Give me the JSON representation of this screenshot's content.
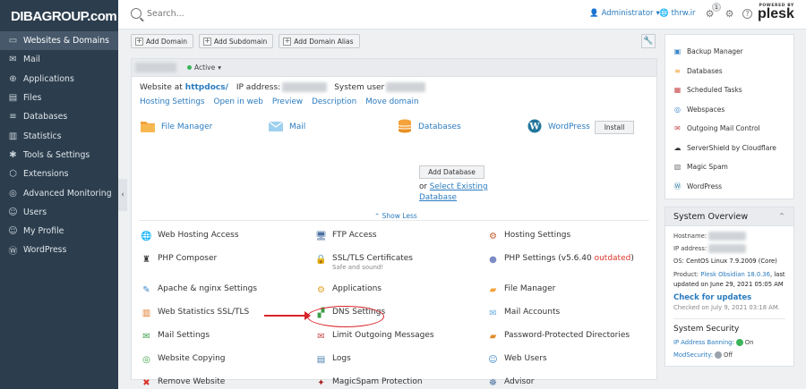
{
  "brand": {
    "logo_text": "DIBAGROUP.com"
  },
  "sidebar": {
    "items": [
      {
        "label": "Websites & Domains",
        "icon": "monitor-icon",
        "active": true
      },
      {
        "label": "Mail",
        "icon": "mail-icon"
      },
      {
        "label": "Applications",
        "icon": "applications-icon"
      },
      {
        "label": "Files",
        "icon": "files-icon"
      },
      {
        "label": "Databases",
        "icon": "database-icon"
      },
      {
        "label": "Statistics",
        "icon": "statistics-icon"
      },
      {
        "label": "Tools & Settings",
        "icon": "tools-icon"
      },
      {
        "label": "Extensions",
        "icon": "extensions-icon"
      },
      {
        "label": "Advanced Monitoring",
        "icon": "monitoring-icon"
      },
      {
        "label": "Users",
        "icon": "users-icon"
      },
      {
        "label": "My Profile",
        "icon": "profile-icon"
      },
      {
        "label": "WordPress",
        "icon": "wordpress-icon"
      }
    ]
  },
  "header": {
    "search_placeholder": "Search...",
    "user": "Administrator",
    "site": "thrw.ir",
    "notification_count": "1",
    "powered_by": "POWERED BY",
    "plesk": "plesk"
  },
  "toolbar": {
    "add_domain": "Add Domain",
    "add_subdomain": "Add Subdomain",
    "add_domain_alias": "Add Domain Alias"
  },
  "domain": {
    "status": "Active",
    "website_at_label": "Website at",
    "website_path": "httpdocs/",
    "ip_label": "IP address:",
    "system_user_label": "System user"
  },
  "domain_links": [
    "Hosting Settings",
    "Open in web",
    "Preview",
    "Description",
    "Move domain"
  ],
  "services": {
    "file_manager": "File Manager",
    "mail": "Mail",
    "databases": "Databases",
    "add_database": "Add Database",
    "or_text": "or",
    "select_existing": "Select Existing Database",
    "wordpress": "WordPress",
    "install": "Install"
  },
  "show_less": "Show Less",
  "tools": [
    {
      "label": "Web Hosting Access",
      "icon": "web-hosting-icon"
    },
    {
      "label": "FTP Access",
      "icon": "ftp-icon"
    },
    {
      "label": "Hosting Settings",
      "icon": "hosting-settings-icon"
    },
    {
      "label": "PHP Composer",
      "icon": "php-composer-icon"
    },
    {
      "label": "SSL/TLS Certificates",
      "sub": "Safe and sound!",
      "icon": "ssl-lock-icon"
    },
    {
      "label": "PHP Settings (v5.6.40 ",
      "extra": "outdated",
      "tail": ")",
      "icon": "php-icon"
    },
    {
      "label": "Apache & nginx Settings",
      "icon": "apache-nginx-icon"
    },
    {
      "label": "Applications",
      "icon": "applications-gear-icon"
    },
    {
      "label": "File Manager",
      "icon": "folder-icon"
    },
    {
      "label": "Web Statistics SSL/TLS",
      "icon": "web-statistics-icon"
    },
    {
      "label": "DNS Settings",
      "icon": "dns-icon"
    },
    {
      "label": "Mail Accounts",
      "icon": "mail-accounts-icon"
    },
    {
      "label": "Mail Settings",
      "icon": "mail-settings-icon"
    },
    {
      "label": "Limit Outgoing Messages",
      "icon": "limit-mail-icon"
    },
    {
      "label": "Password-Protected Directories",
      "icon": "protected-dir-icon"
    },
    {
      "label": "Website Copying",
      "icon": "website-copy-icon"
    },
    {
      "label": "Logs",
      "icon": "logs-icon"
    },
    {
      "label": "Web Users",
      "icon": "web-users-icon"
    },
    {
      "label": "Remove Website",
      "icon": "remove-icon"
    },
    {
      "label": "MagicSpam Protection",
      "icon": "magicspam-icon"
    },
    {
      "label": "Advisor",
      "icon": "advisor-icon"
    }
  ],
  "right_links": [
    {
      "label": "Backup Manager",
      "icon": "backup-icon"
    },
    {
      "label": "Databases",
      "icon": "database-small-icon"
    },
    {
      "label": "Scheduled Tasks",
      "icon": "scheduled-icon"
    },
    {
      "label": "Webspaces",
      "icon": "webspaces-icon"
    },
    {
      "label": "Outgoing Mail Control",
      "icon": "outgoing-mail-icon"
    },
    {
      "label": "ServerShield by Cloudflare",
      "icon": "cloudflare-icon"
    },
    {
      "label": "Magic Spam",
      "icon": "magic-spam-icon"
    },
    {
      "label": "WordPress",
      "icon": "wordpress-small-icon"
    }
  ],
  "system_overview": {
    "title": "System Overview",
    "hostname_label": "Hostname:",
    "ip_label": "IP address:",
    "os_label": "OS:",
    "os_value": "CentOS Linux 7.9.2009 (Core)",
    "product_label": "Product:",
    "product_name": "Plesk Obsidian 18.0.36",
    "product_tail": ", last updated on June 29, 2021 05:05 AM",
    "check_updates": "Check for updates",
    "checked_on": "Checked on July 9, 2021 03:18 AM.",
    "security_title": "System Security",
    "ip_banning": "IP Address Banning:",
    "ip_banning_state": "On",
    "modsecurity": "ModSecurity:",
    "modsecurity_state": "Off"
  }
}
